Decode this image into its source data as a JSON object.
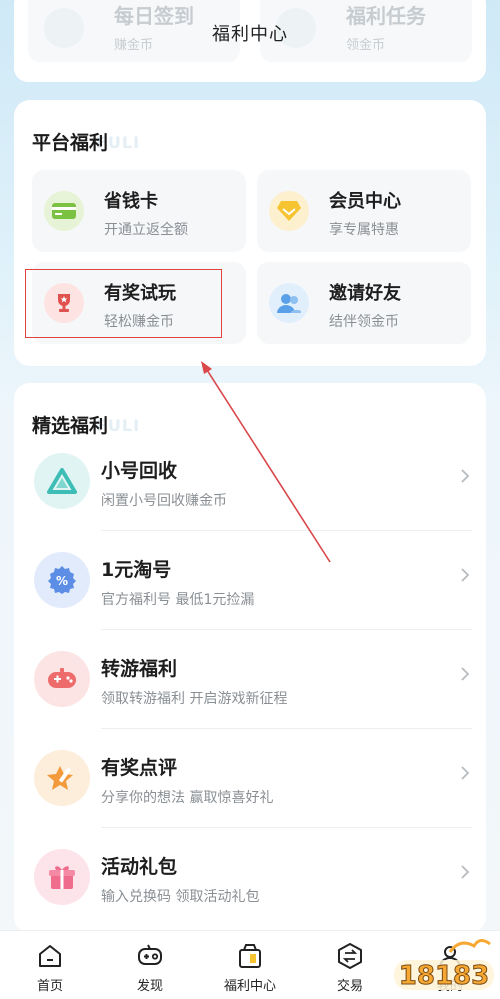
{
  "header": {
    "title": "福利中心"
  },
  "top_partial": [
    {
      "title": "每日签到",
      "sub": "赚金币"
    },
    {
      "title": "福利任务",
      "sub": "领金币"
    }
  ],
  "platform": {
    "heading": "平台福利",
    "ghost": "FULI",
    "tiles": [
      {
        "title": "省钱卡",
        "sub": "开通立返全额",
        "icon": "card-icon",
        "color": "#8bc34a"
      },
      {
        "title": "会员中心",
        "sub": "享专属特惠",
        "icon": "diamond-icon",
        "color": "#f5c12e"
      },
      {
        "title": "有奖试玩",
        "sub": "轻松赚金币",
        "icon": "trophy-icon",
        "color": "#e0524e"
      },
      {
        "title": "邀请好友",
        "sub": "结伴领金币",
        "icon": "friends-icon",
        "color": "#5aa0e8"
      }
    ]
  },
  "selected": {
    "heading": "精选福利",
    "ghost": "FULI",
    "items": [
      {
        "title": "小号回收",
        "sub": "闲置小号回收赚金币",
        "icon": "recycle-icon"
      },
      {
        "title": "1元淘号",
        "sub": "官方福利号 最低1元捡漏",
        "icon": "discount-icon"
      },
      {
        "title": "转游福利",
        "sub": "领取转游福利 开启游戏新征程",
        "icon": "gamepad-icon"
      },
      {
        "title": "有奖点评",
        "sub": "分享你的想法 赢取惊喜好礼",
        "icon": "pen-star-icon"
      },
      {
        "title": "活动礼包",
        "sub": "输入兑换码 领取活动礼包",
        "icon": "gift-icon"
      }
    ]
  },
  "tabbar": {
    "items": [
      {
        "label": "首页",
        "icon": "home-icon"
      },
      {
        "label": "发现",
        "icon": "gamepad-plus-icon"
      },
      {
        "label": "福利中心",
        "icon": "welfare-icon"
      },
      {
        "label": "交易",
        "icon": "exchange-icon"
      },
      {
        "label": "我的",
        "icon": "profile-icon"
      }
    ]
  },
  "watermark": {
    "text": "18183"
  },
  "colors": {
    "accent_red": "#e0433e",
    "arrow": "#d9474a"
  }
}
